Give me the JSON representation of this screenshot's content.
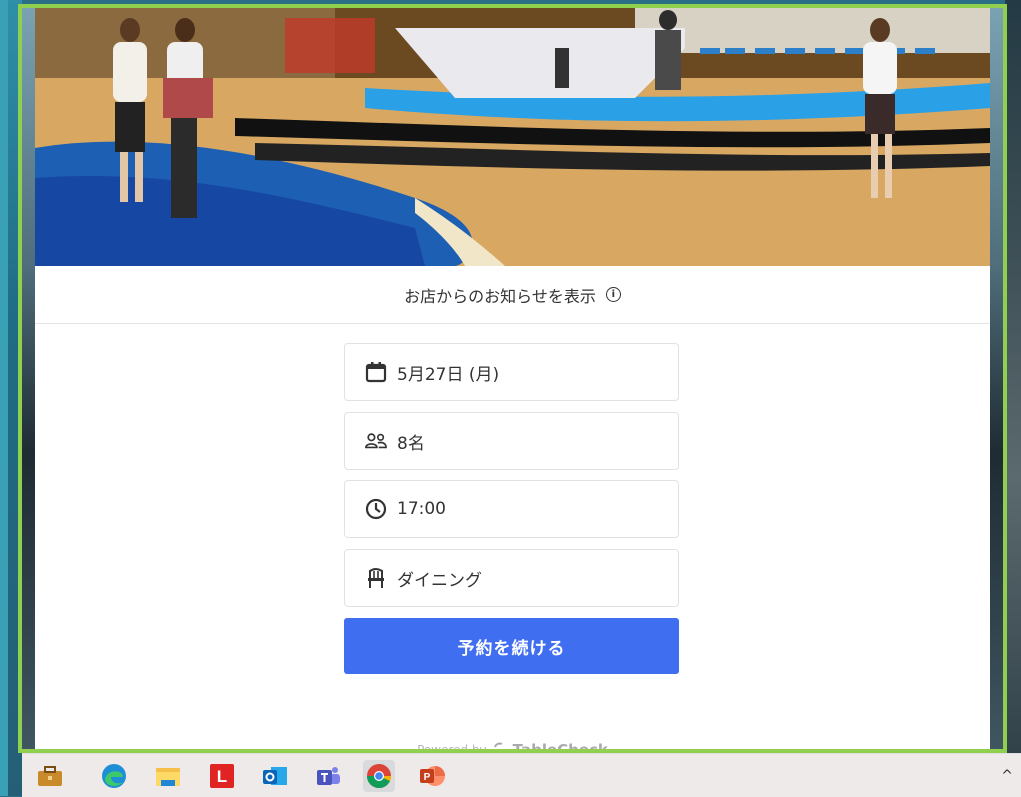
{
  "notice": {
    "text": "お店からのお知らせを表示",
    "icon": "info-icon"
  },
  "booking": {
    "date": "5月27日 (月)",
    "party_size": "8名",
    "time": "17:00",
    "seating": "ダイニング",
    "icons": [
      "calendar-icon",
      "people-icon",
      "clock-icon",
      "chair-icon"
    ]
  },
  "continue_label": "予約を続ける",
  "footer": {
    "powered_by": "Powered by",
    "brand": "TableCheck"
  },
  "taskbar": {
    "apps": [
      "briefcase-icon",
      "edge-icon",
      "file-explorer-icon",
      "l-app-icon",
      "outlook-icon",
      "teams-icon",
      "chrome-icon",
      "powerpoint-icon"
    ],
    "active": "chrome-icon",
    "lapp_letter": "L",
    "chevron": "^"
  },
  "colors": {
    "window_border": "#8fd14f",
    "button": "#3f6ef0",
    "taskbar": "#eeeaea"
  }
}
